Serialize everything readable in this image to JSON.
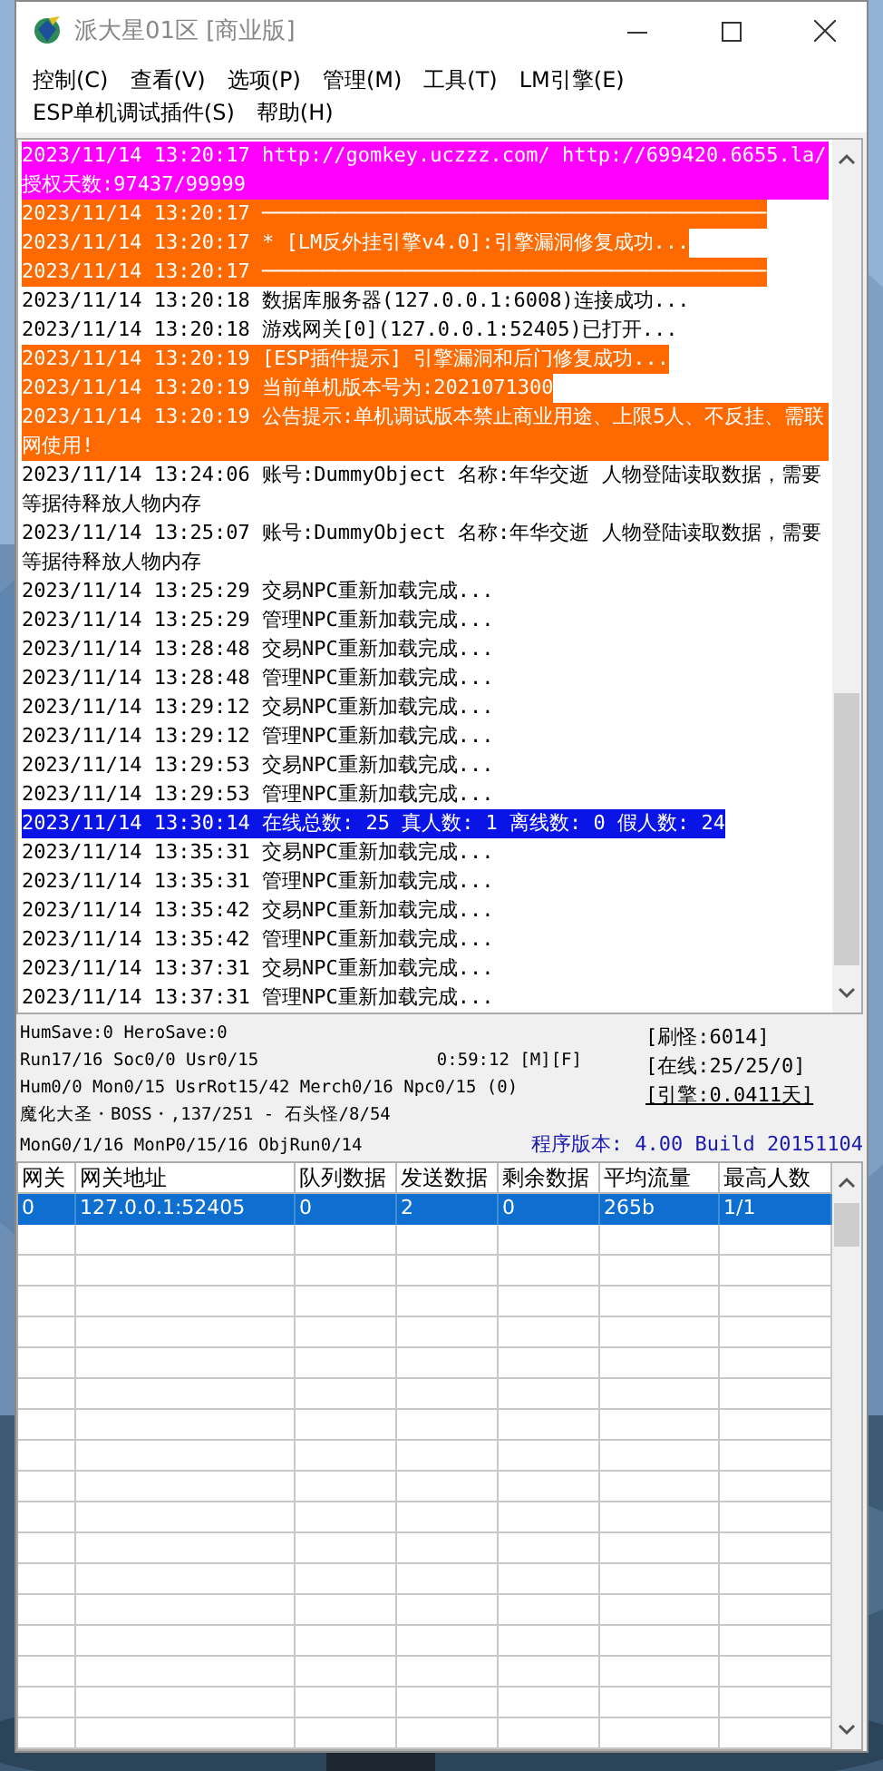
{
  "window": {
    "title": "派大星01区 [商业版]"
  },
  "menu": [
    "控制(C)",
    "查看(V)",
    "选项(P)",
    "管理(M)",
    "工具(T)",
    "LM引擎(E)",
    "ESP单机调试插件(S)",
    "帮助(H)"
  ],
  "log": [
    {
      "text": "2023/11/14 13:20:17 http://gomkey.uczzz.com/ http://699420.6655.la/ 授权天数:97437/99999",
      "color": "#ff00ff",
      "selected": false
    },
    {
      "text": "2023/11/14 13:20:17 ──────────────────────────────────────────",
      "color": "#ff6a00",
      "selected": false
    },
    {
      "text": "2023/11/14 13:20:17 * [LM反外挂引擎v4.0]:引擎漏洞修复成功...",
      "color": "#ff6a00",
      "selected": false
    },
    {
      "text": "2023/11/14 13:20:17 ──────────────────────────────────────────",
      "color": "#ff6a00",
      "selected": false
    },
    {
      "text": "2023/11/14 13:20:18 数据库服务器(127.0.0.1:6008)连接成功...",
      "selected": false
    },
    {
      "text": "2023/11/14 13:20:18 游戏网关[0](127.0.0.1:52405)已打开...",
      "selected": false
    },
    {
      "text": "2023/11/14 13:20:19 [ESP插件提示] 引擎漏洞和后门修复成功...",
      "color": "#ff6a00",
      "selected": false
    },
    {
      "text": "2023/11/14 13:20:19 当前单机版本号为:2021071300",
      "color": "#ff6a00",
      "selected": false
    },
    {
      "text": "2023/11/14 13:20:19 公告提示:单机调试版本禁止商业用途、上限5人、不反挂、需联网使用!",
      "color": "#ff6a00",
      "selected": false
    },
    {
      "text": "2023/11/14 13:24:06 账号:DummyObject 名称:年华交逝 人物登陆读取数据，需要等据待释放人物内存",
      "selected": false
    },
    {
      "text": "2023/11/14 13:25:07 账号:DummyObject 名称:年华交逝 人物登陆读取数据，需要等据待释放人物内存",
      "selected": false
    },
    {
      "text": "2023/11/14 13:25:29 交易NPC重新加载完成...",
      "selected": false
    },
    {
      "text": "2023/11/14 13:25:29 管理NPC重新加载完成...",
      "selected": false
    },
    {
      "text": "2023/11/14 13:28:48 交易NPC重新加载完成...",
      "selected": false
    },
    {
      "text": "2023/11/14 13:28:48 管理NPC重新加载完成...",
      "selected": false
    },
    {
      "text": "2023/11/14 13:29:12 交易NPC重新加载完成...",
      "selected": false
    },
    {
      "text": "2023/11/14 13:29:12 管理NPC重新加载完成...",
      "selected": false
    },
    {
      "text": "2023/11/14 13:29:53 交易NPC重新加载完成...",
      "selected": false
    },
    {
      "text": "2023/11/14 13:29:53 管理NPC重新加载完成...",
      "selected": false
    },
    {
      "text": "2023/11/14 13:30:14 在线总数: 25 真人数: 1 离线数: 0 假人数: 24",
      "selected": true
    },
    {
      "text": "2023/11/14 13:35:31 交易NPC重新加载完成...",
      "selected": false
    },
    {
      "text": "2023/11/14 13:35:31 管理NPC重新加载完成...",
      "selected": false
    },
    {
      "text": "2023/11/14 13:35:42 交易NPC重新加载完成...",
      "selected": false
    },
    {
      "text": "2023/11/14 13:35:42 管理NPC重新加载完成...",
      "selected": false
    },
    {
      "text": "2023/11/14 13:37:31 交易NPC重新加载完成...",
      "selected": false
    },
    {
      "text": "2023/11/14 13:37:31 管理NPC重新加载完成...",
      "selected": false
    }
  ],
  "status": {
    "lines": [
      "HumSave:0 HeroSave:0",
      "Run17/16 Soc0/0 Usr0/15",
      "Hum0/0 Mon0/15 UsrRot15/42 Merch0/16 Npc0/15 (0)",
      "魔化大圣・BOSS・,137/251 - 石头怪/8/54",
      "MonG0/1/16 MonP0/15/16 ObjRun0/14"
    ],
    "timer": "0:59:12 [M][F]",
    "counters": [
      "[刷怪:6014]",
      "[在线:25/25/0]",
      "[引擎:0.0411天]"
    ],
    "version": "程序版本: 4.00 Build 20151104"
  },
  "table": {
    "columns": [
      "网关",
      "网关地址",
      "队列数据",
      "发送数据",
      "剩余数据",
      "平均流量",
      "最高人数"
    ],
    "rows": [
      {
        "cells": [
          "0",
          "127.0.0.1:52405",
          "0",
          "2",
          "0",
          "265b",
          "1/1"
        ],
        "selected": true
      }
    ]
  }
}
